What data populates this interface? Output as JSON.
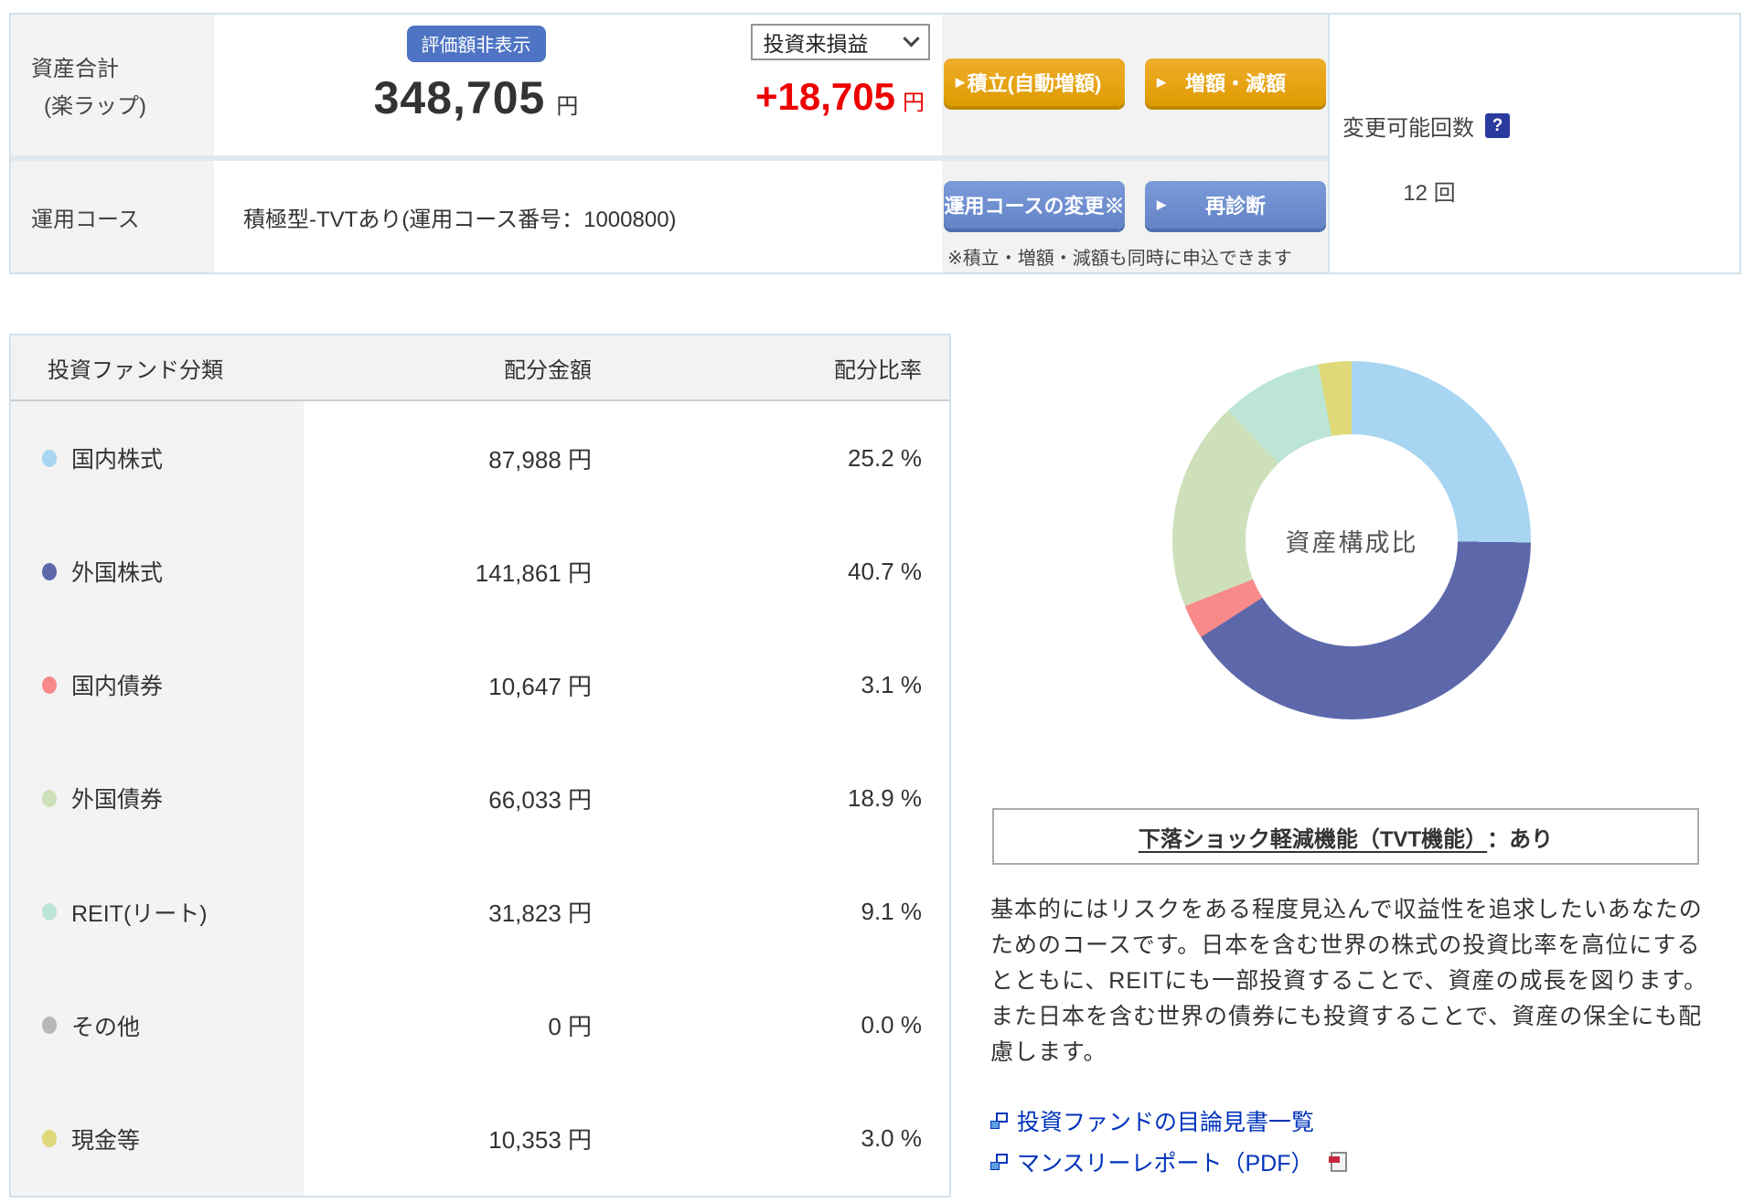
{
  "summary": {
    "asset_label_line1": "資産合計",
    "asset_label_line2": "(楽ラップ)",
    "badge": "評価額非表示",
    "amount": "348,705",
    "amount_unit": "円",
    "pl_select": "投資来損益",
    "pl_amount": "+18,705",
    "pl_unit": "円",
    "btn_reserve": "積立(自動増額)",
    "btn_adjust": "増額・減額",
    "course_label": "運用コース",
    "course_value": "積極型-TVTあり(運用コース番号：1000800)",
    "btn_course_change": "運用コースの変更※",
    "btn_rediagnose": "再診断",
    "note": "※積立・増額・減額も同時に申込できます",
    "changes_label": "変更可能回数",
    "changes_help": "?",
    "changes_value": "12 回"
  },
  "allocation_table": {
    "headers": [
      "投資ファンド分類",
      "配分金額",
      "配分比率"
    ],
    "rows": [
      {
        "label": "国内株式",
        "color": "#a7d5f2",
        "amount": "87,988 円",
        "ratio": "25.2 %"
      },
      {
        "label": "外国株式",
        "color": "#5d68ab",
        "amount": "141,861 円",
        "ratio": "40.7 %"
      },
      {
        "label": "国内債券",
        "color": "#f98a8a",
        "amount": "10,647 円",
        "ratio": "3.1 %"
      },
      {
        "label": "外国債券",
        "color": "#cde0ba",
        "amount": "66,033 円",
        "ratio": "18.9 %"
      },
      {
        "label": "REIT(リート)",
        "color": "#bce5d5",
        "amount": "31,823 円",
        "ratio": "9.1 %"
      },
      {
        "label": "その他",
        "color": "#b8b8b8",
        "amount": "0 円",
        "ratio": "0.0 %"
      },
      {
        "label": "現金等",
        "color": "#dfd97a",
        "amount": "10,353 円",
        "ratio": "3.0 %"
      }
    ]
  },
  "chart_data": {
    "type": "pie",
    "donut": true,
    "title": "資産構成比",
    "center_label": "資産構成比",
    "labels": [
      "国内株式",
      "外国株式",
      "国内債券",
      "外国債券",
      "REIT(リート)",
      "その他",
      "現金等"
    ],
    "values": [
      25.2,
      40.7,
      3.1,
      18.9,
      9.1,
      0.0,
      3.0
    ],
    "amounts_jpy": [
      87988,
      141861,
      10647,
      66033,
      31823,
      0,
      10353
    ],
    "colors": [
      "#a7d5f2",
      "#5d68ab",
      "#f98a8a",
      "#cde0ba",
      "#bce5d5",
      "#b8b8b8",
      "#dfd97a"
    ],
    "legend_position": "none"
  },
  "tvt": {
    "heading_main": "下落ショック軽減機能（TVT機能）",
    "heading_suffix": "：あり",
    "description": "基本的にはリスクをある程度見込んで収益性を追求したいあなたのためのコースです。日本を含む世界の株式の投資比率を高位にするとともに、REITにも一部投資することで、資産の成長を図ります。また日本を含む世界の債券にも投資することで、資産の保全にも配慮します。"
  },
  "links": {
    "prospectus": "投資ファンドの目論見書一覧",
    "monthly_report": "マンスリーレポート（PDF）"
  }
}
